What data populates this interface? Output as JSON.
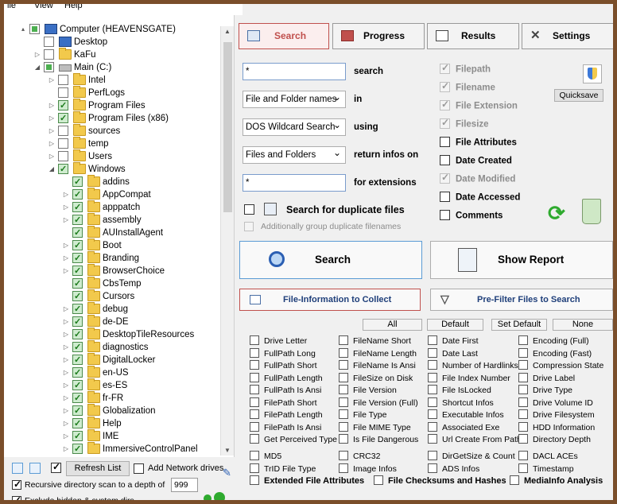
{
  "menu": {
    "items": [
      "ile",
      "View",
      "Help"
    ]
  },
  "tree": {
    "items": [
      {
        "label": "Computer (HEAVENSGATE)",
        "level": 0,
        "type": "pc",
        "check": "part",
        "exp": "▴"
      },
      {
        "label": "Desktop",
        "level": 1,
        "type": "desktop",
        "check": "off",
        "exp": ""
      },
      {
        "label": "KaFu",
        "level": 1,
        "type": "folder",
        "check": "off",
        "exp": "▷"
      },
      {
        "label": "Main (C:)",
        "level": 1,
        "type": "drive",
        "check": "part",
        "exp": "◢"
      },
      {
        "label": "Intel",
        "level": 2,
        "type": "folder",
        "check": "off",
        "exp": "▷"
      },
      {
        "label": "PerfLogs",
        "level": 2,
        "type": "folder",
        "check": "off",
        "exp": ""
      },
      {
        "label": "Program Files",
        "level": 2,
        "type": "folder",
        "check": "on",
        "exp": "▷"
      },
      {
        "label": "Program Files (x86)",
        "level": 2,
        "type": "folder",
        "check": "on",
        "exp": "▷"
      },
      {
        "label": "sources",
        "level": 2,
        "type": "folder",
        "check": "off",
        "exp": "▷"
      },
      {
        "label": "temp",
        "level": 2,
        "type": "folder",
        "check": "off",
        "exp": "▷"
      },
      {
        "label": "Users",
        "level": 2,
        "type": "folder",
        "check": "off",
        "exp": "▷"
      },
      {
        "label": "Windows",
        "level": 2,
        "type": "folder",
        "check": "on",
        "exp": "◢"
      },
      {
        "label": "addins",
        "level": 3,
        "type": "folder",
        "check": "on",
        "exp": ""
      },
      {
        "label": "AppCompat",
        "level": 3,
        "type": "folder",
        "check": "on",
        "exp": "▷"
      },
      {
        "label": "apppatch",
        "level": 3,
        "type": "folder",
        "check": "on",
        "exp": "▷"
      },
      {
        "label": "assembly",
        "level": 3,
        "type": "folder",
        "check": "on",
        "exp": "▷"
      },
      {
        "label": "AUInstallAgent",
        "level": 3,
        "type": "folder",
        "check": "on",
        "exp": ""
      },
      {
        "label": "Boot",
        "level": 3,
        "type": "folder",
        "check": "on",
        "exp": "▷"
      },
      {
        "label": "Branding",
        "level": 3,
        "type": "folder",
        "check": "on",
        "exp": "▷"
      },
      {
        "label": "BrowserChoice",
        "level": 3,
        "type": "folder",
        "check": "on",
        "exp": "▷"
      },
      {
        "label": "CbsTemp",
        "level": 3,
        "type": "folder",
        "check": "on",
        "exp": ""
      },
      {
        "label": "Cursors",
        "level": 3,
        "type": "folder",
        "check": "on",
        "exp": ""
      },
      {
        "label": "debug",
        "level": 3,
        "type": "folder",
        "check": "on",
        "exp": "▷"
      },
      {
        "label": "de-DE",
        "level": 3,
        "type": "folder",
        "check": "on",
        "exp": "▷"
      },
      {
        "label": "DesktopTileResources",
        "level": 3,
        "type": "folder",
        "check": "on",
        "exp": "▷"
      },
      {
        "label": "diagnostics",
        "level": 3,
        "type": "folder",
        "check": "on",
        "exp": "▷"
      },
      {
        "label": "DigitalLocker",
        "level": 3,
        "type": "folder",
        "check": "on",
        "exp": "▷"
      },
      {
        "label": "en-US",
        "level": 3,
        "type": "folder",
        "check": "on",
        "exp": "▷"
      },
      {
        "label": "es-ES",
        "level": 3,
        "type": "folder",
        "check": "on",
        "exp": "▷"
      },
      {
        "label": "fr-FR",
        "level": 3,
        "type": "folder",
        "check": "on",
        "exp": "▷"
      },
      {
        "label": "Globalization",
        "level": 3,
        "type": "folder",
        "check": "on",
        "exp": "▷"
      },
      {
        "label": "Help",
        "level": 3,
        "type": "folder",
        "check": "on",
        "exp": "▷"
      },
      {
        "label": "IME",
        "level": 3,
        "type": "folder",
        "check": "on",
        "exp": "▷"
      },
      {
        "label": "ImmersiveControlPanel",
        "level": 3,
        "type": "folder",
        "check": "on",
        "exp": "▷"
      }
    ]
  },
  "left_bottom": {
    "refresh_label": "Refresh List",
    "add_network_label": "Add Network drives",
    "recursive_label": "Recursive directory scan to a depth of",
    "depth_value": "999",
    "partial_label": "Exclude hidden & system dirs..."
  },
  "tabs": [
    {
      "label": "Search",
      "active": true
    },
    {
      "label": "Progress",
      "active": false
    },
    {
      "label": "Results",
      "active": false
    },
    {
      "label": "Settings",
      "active": false
    }
  ],
  "search_form": {
    "query_value": "*",
    "query_label": "search",
    "mode_value": "File and Folder names",
    "mode_label": "in",
    "pattern_value": "DOS Wildcard Search",
    "pattern_label": "using",
    "return_value": "Files and Folders",
    "return_label": "return infos on",
    "ext_value": "*",
    "ext_label": "for extensions",
    "dup_label": "Search for duplicate files",
    "dup_sub_label": "Additionally group duplicate filenames"
  },
  "right_options": [
    {
      "label": "Filepath",
      "checked": true,
      "disabled": true
    },
    {
      "label": "Filename",
      "checked": true,
      "disabled": true
    },
    {
      "label": "File Extension",
      "checked": true,
      "disabled": true
    },
    {
      "label": "Filesize",
      "checked": true,
      "disabled": true
    },
    {
      "label": "File Attributes",
      "checked": false,
      "disabled": false
    },
    {
      "label": "Date Created",
      "checked": false,
      "disabled": false
    },
    {
      "label": "Date Modified",
      "checked": true,
      "disabled": true
    },
    {
      "label": "Date Accessed",
      "checked": false,
      "disabled": false
    },
    {
      "label": "Comments",
      "checked": false,
      "disabled": false
    }
  ],
  "quicksave_label": "Quicksave",
  "big_buttons": {
    "search": "Search",
    "report": "Show Report"
  },
  "sections": {
    "collect": "File-Information to Collect",
    "prefilter": "Pre-Filter Files to Search"
  },
  "set_buttons": {
    "all": "All",
    "default": "Default",
    "set_default": "Set Default",
    "none": "None"
  },
  "info_columns": [
    [
      "Drive Letter",
      "FullPath Long",
      "FullPath Short",
      "FullPath Length",
      "FullPath Is Ansi",
      "FilePath Short",
      "FilePath Length",
      "FilePath Is Ansi",
      "Get Perceived Type"
    ],
    [
      "FileName Short",
      "FileName Length",
      "FileName Is Ansi",
      "FileSize on Disk",
      "File Version",
      "File Version (Full)",
      "File Type",
      "File MIME Type",
      "Is File Dangerous"
    ],
    [
      "Date First",
      "Date Last",
      "Number of Hardlinks",
      "File Index Number",
      "File IsLocked",
      "Shortcut Infos",
      "Executable Infos",
      "Associated Exe",
      "Url Create From Path"
    ],
    [
      "Encoding (Full)",
      "Encoding (Fast)",
      "Compression State",
      "Drive Label",
      "Drive Type",
      "Drive Volume ID",
      "Drive Filesystem",
      "HDD Information",
      "Directory Depth"
    ]
  ],
  "info_extra": [
    [
      "MD5",
      "CRC32",
      "DirGetSize & Count",
      "DACL ACEs"
    ],
    [
      "TrID File Type",
      "Image Infos",
      "ADS Infos",
      "Timestamp"
    ]
  ],
  "group_labels": [
    "Extended File Attributes",
    "File Checksums and Hashes",
    "MediaInfo Analysis"
  ]
}
